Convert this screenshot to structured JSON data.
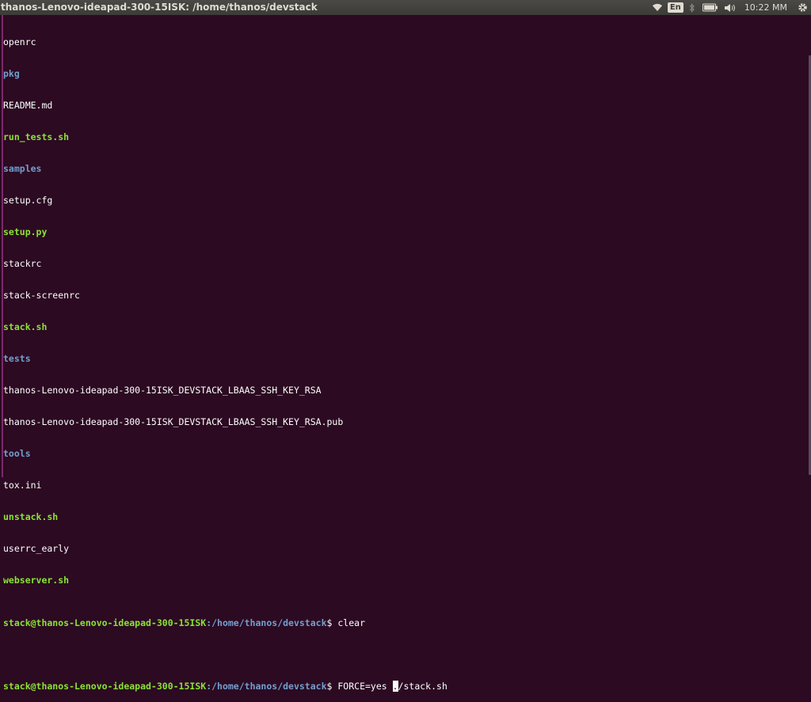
{
  "window": {
    "title": "thanos-Lenovo-ideapad-300-15ISK: /home/thanos/devstack"
  },
  "tray": {
    "wifi_icon": "wifi-icon",
    "keyboard_layout": "En",
    "bluetooth_icon": "bluetooth-icon",
    "battery_icon": "battery-icon",
    "volume_icon": "volume-icon",
    "clock": "10:22 MM",
    "settings_icon": "gear-icon"
  },
  "colors": {
    "background": "#2c0a22",
    "directory": "#729fcf",
    "executable": "#8ae234",
    "prompt_user": "#8ae234",
    "prompt_path": "#729fcf"
  },
  "listing": [
    {
      "name": "openrc",
      "type": "file"
    },
    {
      "name": "pkg",
      "type": "directory"
    },
    {
      "name": "README.md",
      "type": "file"
    },
    {
      "name": "run_tests.sh",
      "type": "executable"
    },
    {
      "name": "samples",
      "type": "directory"
    },
    {
      "name": "setup.cfg",
      "type": "file"
    },
    {
      "name": "setup.py",
      "type": "executable"
    },
    {
      "name": "stackrc",
      "type": "file"
    },
    {
      "name": "stack-screenrc",
      "type": "file"
    },
    {
      "name": "stack.sh",
      "type": "executable"
    },
    {
      "name": "tests",
      "type": "directory"
    },
    {
      "name": "thanos-Lenovo-ideapad-300-15ISK_DEVSTACK_LBAAS_SSH_KEY_RSA",
      "type": "file"
    },
    {
      "name": "thanos-Lenovo-ideapad-300-15ISK_DEVSTACK_LBAAS_SSH_KEY_RSA.pub",
      "type": "file"
    },
    {
      "name": "tools",
      "type": "directory"
    },
    {
      "name": "tox.ini",
      "type": "file"
    },
    {
      "name": "unstack.sh",
      "type": "executable"
    },
    {
      "name": "userrc_early",
      "type": "file"
    },
    {
      "name": "webserver.sh",
      "type": "executable"
    }
  ],
  "prompt": {
    "user_host": "stack@thanos-Lenovo-ideapad-300-15ISK",
    "path": ":/home/thanos/devstack",
    "symbol": "$"
  },
  "commands": {
    "first": " clear",
    "second_before_cursor": " FORCE=yes ",
    "second_cursor_char": ".",
    "second_after_cursor": "/stack.sh"
  }
}
